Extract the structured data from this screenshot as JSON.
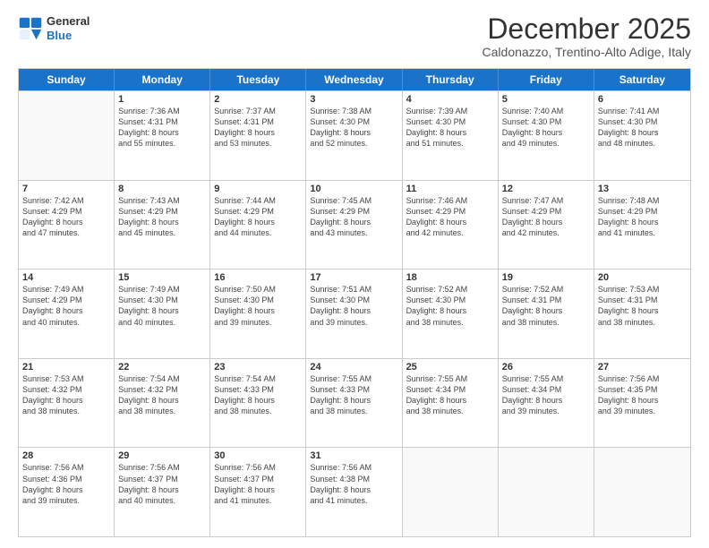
{
  "logo": {
    "line1": "General",
    "line2": "Blue"
  },
  "title": "December 2025",
  "subtitle": "Caldonazzo, Trentino-Alto Adige, Italy",
  "header_days": [
    "Sunday",
    "Monday",
    "Tuesday",
    "Wednesday",
    "Thursday",
    "Friday",
    "Saturday"
  ],
  "rows": [
    [
      {
        "day": "",
        "lines": []
      },
      {
        "day": "1",
        "lines": [
          "Sunrise: 7:36 AM",
          "Sunset: 4:31 PM",
          "Daylight: 8 hours",
          "and 55 minutes."
        ]
      },
      {
        "day": "2",
        "lines": [
          "Sunrise: 7:37 AM",
          "Sunset: 4:31 PM",
          "Daylight: 8 hours",
          "and 53 minutes."
        ]
      },
      {
        "day": "3",
        "lines": [
          "Sunrise: 7:38 AM",
          "Sunset: 4:30 PM",
          "Daylight: 8 hours",
          "and 52 minutes."
        ]
      },
      {
        "day": "4",
        "lines": [
          "Sunrise: 7:39 AM",
          "Sunset: 4:30 PM",
          "Daylight: 8 hours",
          "and 51 minutes."
        ]
      },
      {
        "day": "5",
        "lines": [
          "Sunrise: 7:40 AM",
          "Sunset: 4:30 PM",
          "Daylight: 8 hours",
          "and 49 minutes."
        ]
      },
      {
        "day": "6",
        "lines": [
          "Sunrise: 7:41 AM",
          "Sunset: 4:30 PM",
          "Daylight: 8 hours",
          "and 48 minutes."
        ]
      }
    ],
    [
      {
        "day": "7",
        "lines": [
          "Sunrise: 7:42 AM",
          "Sunset: 4:29 PM",
          "Daylight: 8 hours",
          "and 47 minutes."
        ]
      },
      {
        "day": "8",
        "lines": [
          "Sunrise: 7:43 AM",
          "Sunset: 4:29 PM",
          "Daylight: 8 hours",
          "and 45 minutes."
        ]
      },
      {
        "day": "9",
        "lines": [
          "Sunrise: 7:44 AM",
          "Sunset: 4:29 PM",
          "Daylight: 8 hours",
          "and 44 minutes."
        ]
      },
      {
        "day": "10",
        "lines": [
          "Sunrise: 7:45 AM",
          "Sunset: 4:29 PM",
          "Daylight: 8 hours",
          "and 43 minutes."
        ]
      },
      {
        "day": "11",
        "lines": [
          "Sunrise: 7:46 AM",
          "Sunset: 4:29 PM",
          "Daylight: 8 hours",
          "and 42 minutes."
        ]
      },
      {
        "day": "12",
        "lines": [
          "Sunrise: 7:47 AM",
          "Sunset: 4:29 PM",
          "Daylight: 8 hours",
          "and 42 minutes."
        ]
      },
      {
        "day": "13",
        "lines": [
          "Sunrise: 7:48 AM",
          "Sunset: 4:29 PM",
          "Daylight: 8 hours",
          "and 41 minutes."
        ]
      }
    ],
    [
      {
        "day": "14",
        "lines": [
          "Sunrise: 7:49 AM",
          "Sunset: 4:29 PM",
          "Daylight: 8 hours",
          "and 40 minutes."
        ]
      },
      {
        "day": "15",
        "lines": [
          "Sunrise: 7:49 AM",
          "Sunset: 4:30 PM",
          "Daylight: 8 hours",
          "and 40 minutes."
        ]
      },
      {
        "day": "16",
        "lines": [
          "Sunrise: 7:50 AM",
          "Sunset: 4:30 PM",
          "Daylight: 8 hours",
          "and 39 minutes."
        ]
      },
      {
        "day": "17",
        "lines": [
          "Sunrise: 7:51 AM",
          "Sunset: 4:30 PM",
          "Daylight: 8 hours",
          "and 39 minutes."
        ]
      },
      {
        "day": "18",
        "lines": [
          "Sunrise: 7:52 AM",
          "Sunset: 4:30 PM",
          "Daylight: 8 hours",
          "and 38 minutes."
        ]
      },
      {
        "day": "19",
        "lines": [
          "Sunrise: 7:52 AM",
          "Sunset: 4:31 PM",
          "Daylight: 8 hours",
          "and 38 minutes."
        ]
      },
      {
        "day": "20",
        "lines": [
          "Sunrise: 7:53 AM",
          "Sunset: 4:31 PM",
          "Daylight: 8 hours",
          "and 38 minutes."
        ]
      }
    ],
    [
      {
        "day": "21",
        "lines": [
          "Sunrise: 7:53 AM",
          "Sunset: 4:32 PM",
          "Daylight: 8 hours",
          "and 38 minutes."
        ]
      },
      {
        "day": "22",
        "lines": [
          "Sunrise: 7:54 AM",
          "Sunset: 4:32 PM",
          "Daylight: 8 hours",
          "and 38 minutes."
        ]
      },
      {
        "day": "23",
        "lines": [
          "Sunrise: 7:54 AM",
          "Sunset: 4:33 PM",
          "Daylight: 8 hours",
          "and 38 minutes."
        ]
      },
      {
        "day": "24",
        "lines": [
          "Sunrise: 7:55 AM",
          "Sunset: 4:33 PM",
          "Daylight: 8 hours",
          "and 38 minutes."
        ]
      },
      {
        "day": "25",
        "lines": [
          "Sunrise: 7:55 AM",
          "Sunset: 4:34 PM",
          "Daylight: 8 hours",
          "and 38 minutes."
        ]
      },
      {
        "day": "26",
        "lines": [
          "Sunrise: 7:55 AM",
          "Sunset: 4:34 PM",
          "Daylight: 8 hours",
          "and 39 minutes."
        ]
      },
      {
        "day": "27",
        "lines": [
          "Sunrise: 7:56 AM",
          "Sunset: 4:35 PM",
          "Daylight: 8 hours",
          "and 39 minutes."
        ]
      }
    ],
    [
      {
        "day": "28",
        "lines": [
          "Sunrise: 7:56 AM",
          "Sunset: 4:36 PM",
          "Daylight: 8 hours",
          "and 39 minutes."
        ]
      },
      {
        "day": "29",
        "lines": [
          "Sunrise: 7:56 AM",
          "Sunset: 4:37 PM",
          "Daylight: 8 hours",
          "and 40 minutes."
        ]
      },
      {
        "day": "30",
        "lines": [
          "Sunrise: 7:56 AM",
          "Sunset: 4:37 PM",
          "Daylight: 8 hours",
          "and 41 minutes."
        ]
      },
      {
        "day": "31",
        "lines": [
          "Sunrise: 7:56 AM",
          "Sunset: 4:38 PM",
          "Daylight: 8 hours",
          "and 41 minutes."
        ]
      },
      {
        "day": "",
        "lines": []
      },
      {
        "day": "",
        "lines": []
      },
      {
        "day": "",
        "lines": []
      }
    ]
  ]
}
